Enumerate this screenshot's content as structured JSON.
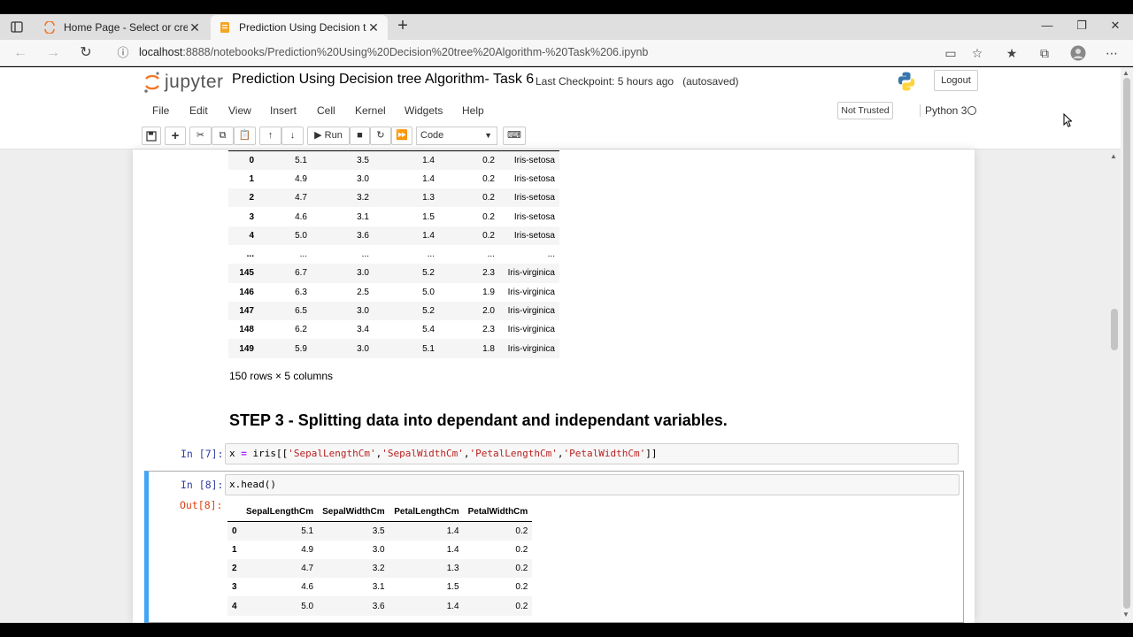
{
  "browser": {
    "tabs": [
      {
        "title": "Home Page - Select or create a n",
        "active": false
      },
      {
        "title": "Prediction Using Decision tree Al",
        "active": true
      }
    ],
    "url_host": "localhost",
    "url_path": ":8888/notebooks/Prediction%20Using%20Decision%20tree%20Algorithm-%20Task%206.ipynb"
  },
  "jupyter": {
    "logo_text": "jupyter",
    "notebook_name": "Prediction Using Decision tree Algorithm- Task 6",
    "checkpoint": "Last Checkpoint: 5 hours ago",
    "autosave": "(autosaved)",
    "logout_label": "Logout",
    "menu": [
      "File",
      "Edit",
      "View",
      "Insert",
      "Cell",
      "Kernel",
      "Widgets",
      "Help"
    ],
    "trust_label": "Not Trusted",
    "kernel_label": "Python 3",
    "toolbar": {
      "run_label": "Run",
      "cell_type": "Code"
    }
  },
  "output_table_1": {
    "rows": [
      [
        "0",
        "5.1",
        "3.5",
        "1.4",
        "0.2",
        "Iris-setosa"
      ],
      [
        "1",
        "4.9",
        "3.0",
        "1.4",
        "0.2",
        "Iris-setosa"
      ],
      [
        "2",
        "4.7",
        "3.2",
        "1.3",
        "0.2",
        "Iris-setosa"
      ],
      [
        "3",
        "4.6",
        "3.1",
        "1.5",
        "0.2",
        "Iris-setosa"
      ],
      [
        "4",
        "5.0",
        "3.6",
        "1.4",
        "0.2",
        "Iris-setosa"
      ],
      [
        "...",
        "...",
        "...",
        "...",
        "...",
        "..."
      ],
      [
        "145",
        "6.7",
        "3.0",
        "5.2",
        "2.3",
        "Iris-virginica"
      ],
      [
        "146",
        "6.3",
        "2.5",
        "5.0",
        "1.9",
        "Iris-virginica"
      ],
      [
        "147",
        "6.5",
        "3.0",
        "5.2",
        "2.0",
        "Iris-virginica"
      ],
      [
        "148",
        "6.2",
        "3.4",
        "5.4",
        "2.3",
        "Iris-virginica"
      ],
      [
        "149",
        "5.9",
        "3.0",
        "5.1",
        "1.8",
        "Iris-virginica"
      ]
    ],
    "summary": "150 rows × 5 columns"
  },
  "markdown_heading": "STEP 3 - Splitting data into dependant and independant variables.",
  "cell7": {
    "prompt": "In [7]:",
    "code_var": "x",
    "code_eq": "=",
    "code_call": " iris[[",
    "code_strings": [
      "'SepalLengthCm'",
      "'SepalWidthCm'",
      "'PetalLengthCm'",
      "'PetalWidthCm'"
    ],
    "code_end": "]]"
  },
  "cell8": {
    "in_prompt": "In [8]:",
    "code": "x.head()",
    "out_prompt": "Out[8]:",
    "columns": [
      "SepalLengthCm",
      "SepalWidthCm",
      "PetalLengthCm",
      "PetalWidthCm"
    ],
    "rows": [
      [
        "0",
        "5.1",
        "3.5",
        "1.4",
        "0.2"
      ],
      [
        "1",
        "4.9",
        "3.0",
        "1.4",
        "0.2"
      ],
      [
        "2",
        "4.7",
        "3.2",
        "1.3",
        "0.2"
      ],
      [
        "3",
        "4.6",
        "3.1",
        "1.5",
        "0.2"
      ],
      [
        "4",
        "5.0",
        "3.6",
        "1.4",
        "0.2"
      ]
    ]
  }
}
